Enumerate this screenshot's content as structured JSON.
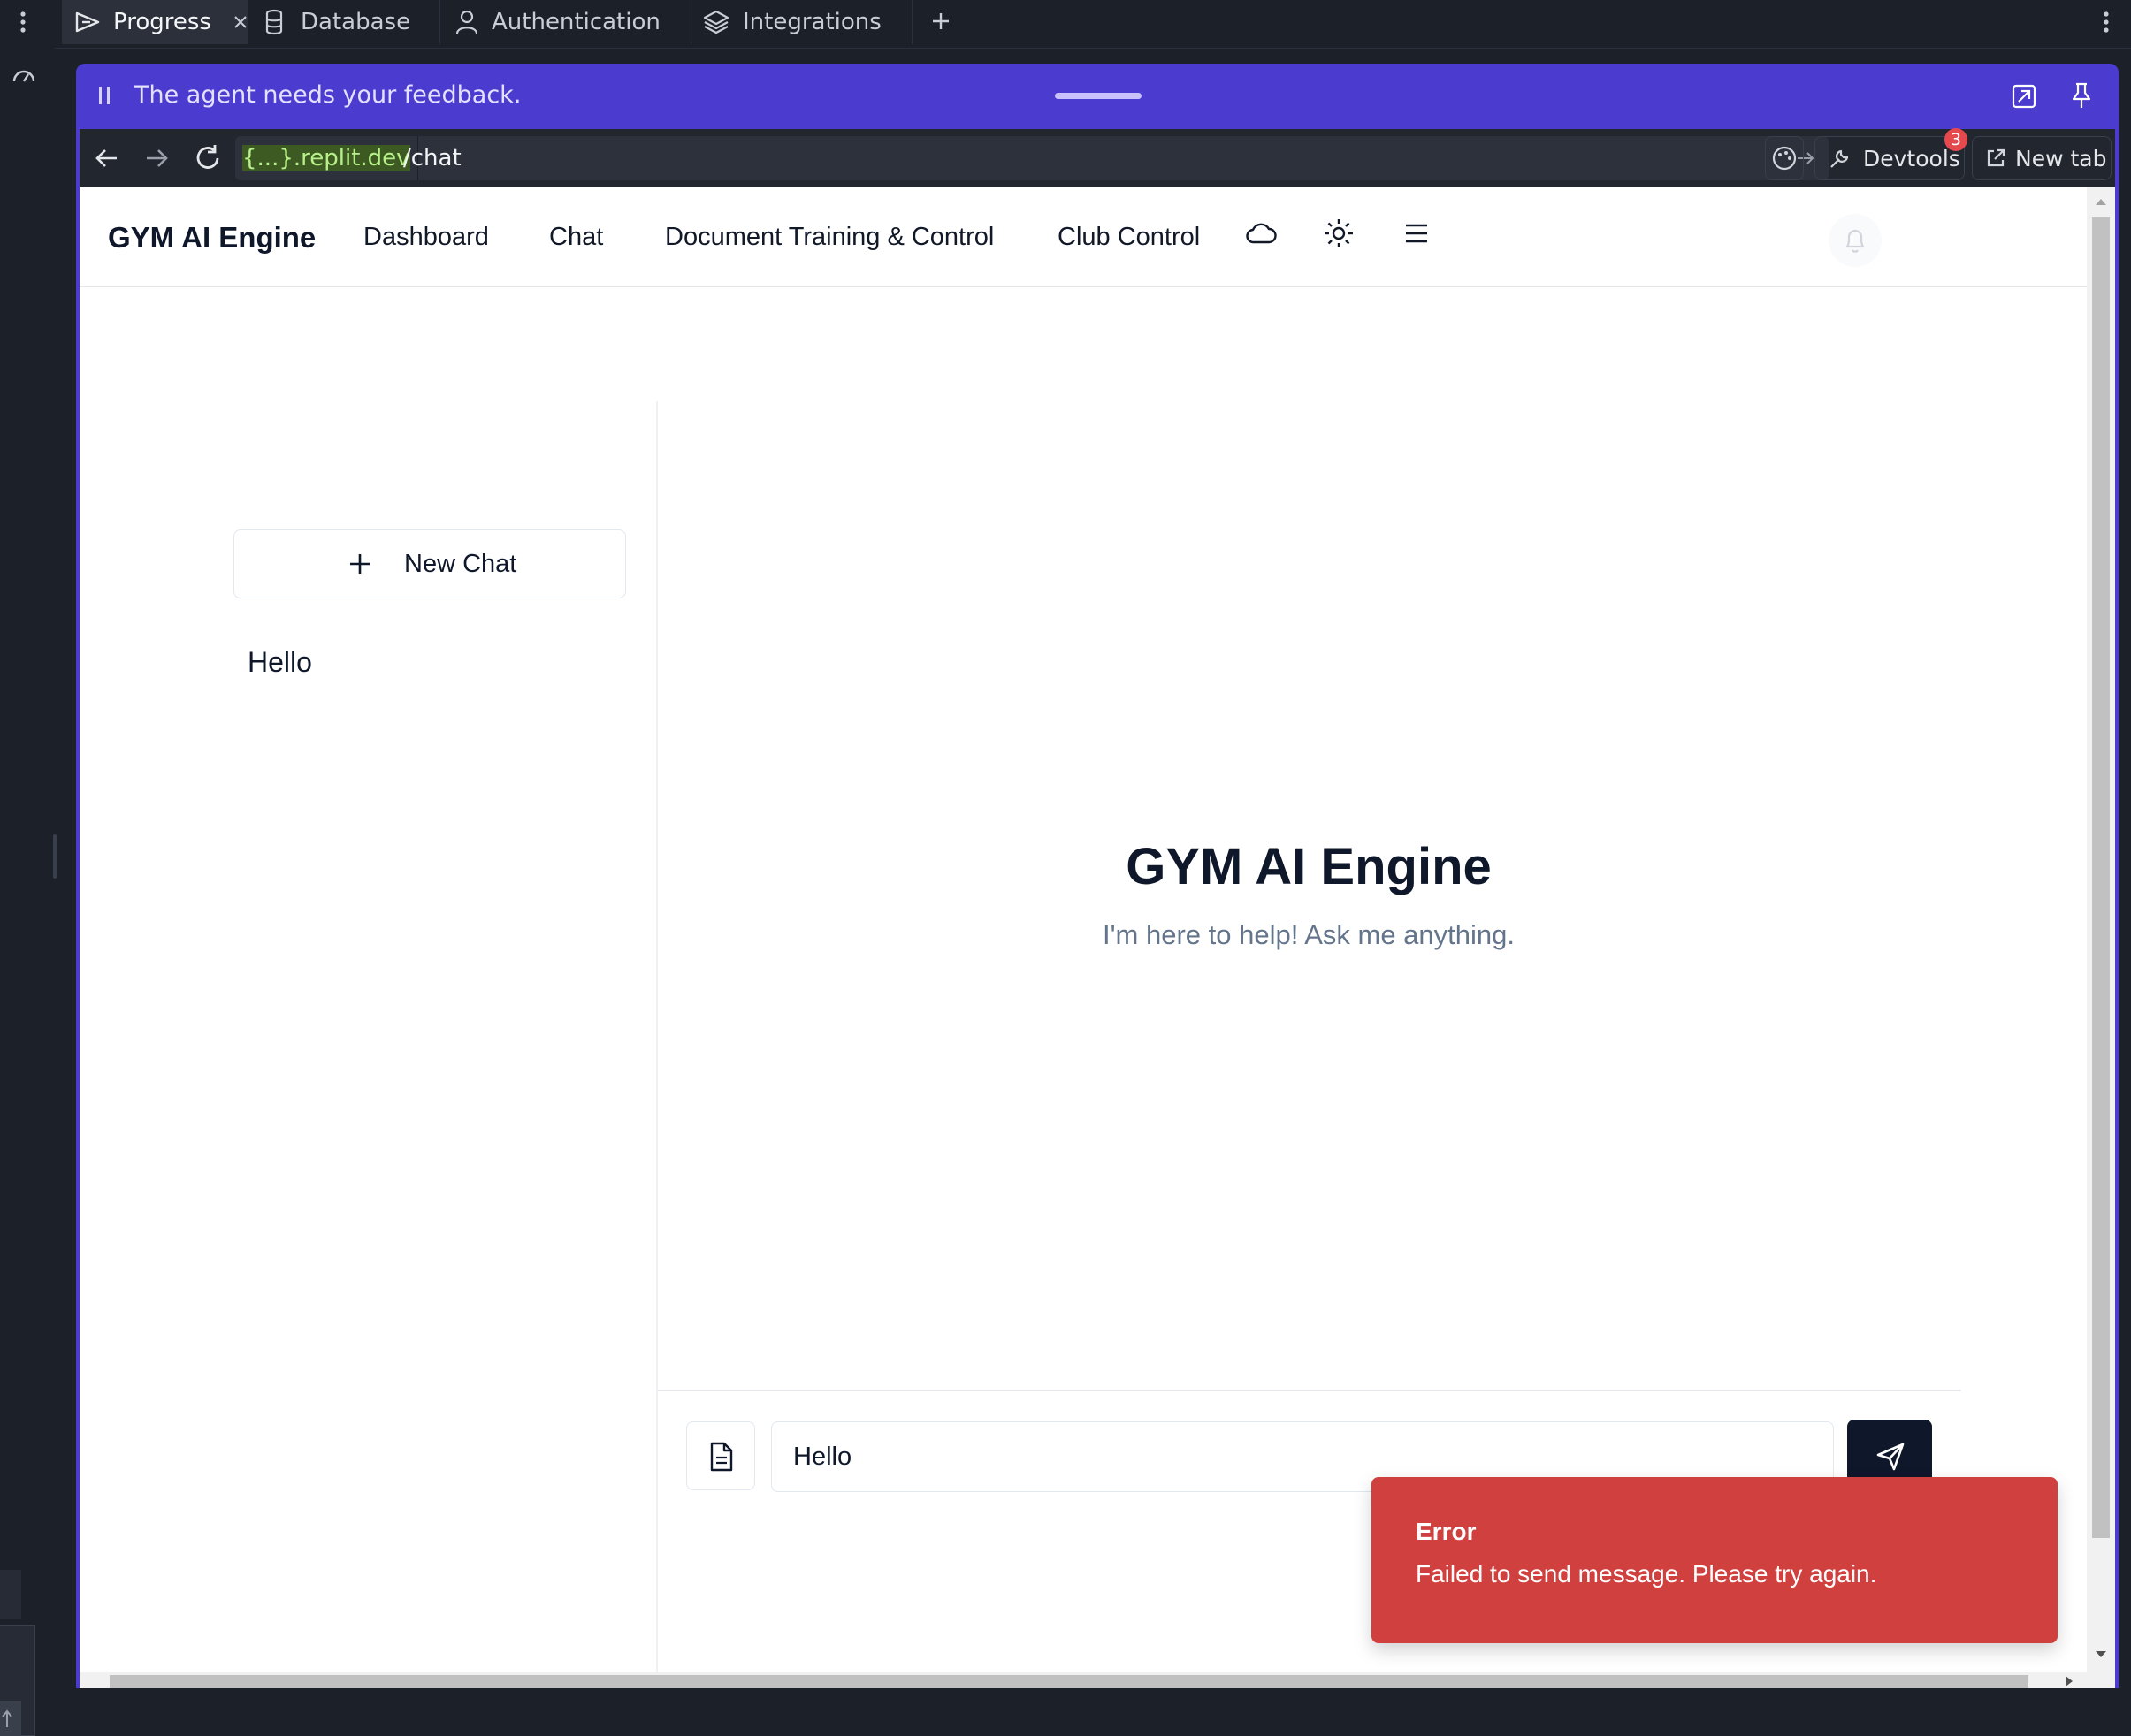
{
  "tabs": [
    {
      "label": "Progress",
      "icon": "progress-icon"
    },
    {
      "label": "Database",
      "icon": "database-icon"
    },
    {
      "label": "Authentication",
      "icon": "user-icon"
    },
    {
      "label": "Integrations",
      "icon": "layers-icon"
    }
  ],
  "feedback_bar": {
    "message": "The agent needs your feedback."
  },
  "browser": {
    "domain": "{...}.replit.dev",
    "path": "/chat",
    "devtools_label": "Devtools",
    "devtools_badge": "3",
    "new_tab_label": "New tab"
  },
  "app": {
    "brand": "GYM AI Engine",
    "nav": [
      "Dashboard",
      "Chat",
      "Document Training & Control",
      "Club Control"
    ]
  },
  "sidebar": {
    "new_chat_label": "New Chat",
    "chats": [
      "Hello"
    ]
  },
  "chat": {
    "heading": "GYM AI Engine",
    "subheading": "I'm here to help! Ask me anything.",
    "input_value": "Hello"
  },
  "toast": {
    "title": "Error",
    "message": "Failed to send message. Please try again.",
    "color": "#d0403f"
  },
  "colors": {
    "feedback_bar": "#4b3ccf",
    "primary_dark": "#0f172a",
    "domain_green": "#8bd16a"
  }
}
